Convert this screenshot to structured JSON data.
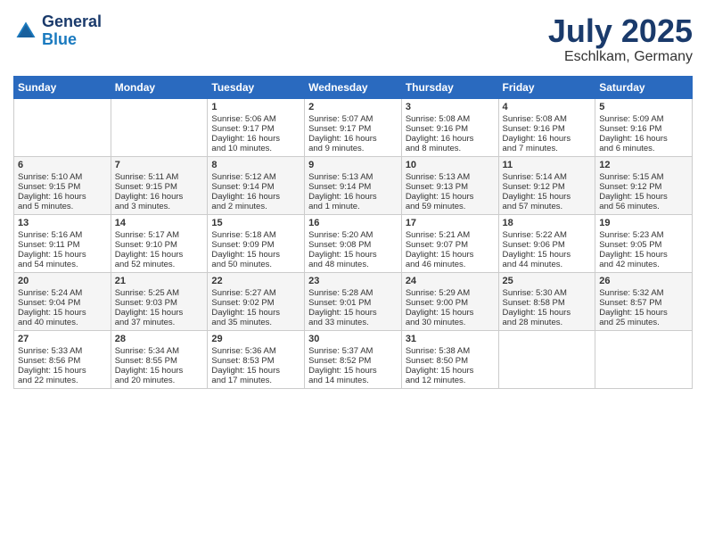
{
  "header": {
    "logo_text_general": "General",
    "logo_text_blue": "Blue",
    "month_year": "July 2025",
    "location": "Eschlkam, Germany"
  },
  "days_of_week": [
    "Sunday",
    "Monday",
    "Tuesday",
    "Wednesday",
    "Thursday",
    "Friday",
    "Saturday"
  ],
  "weeks": [
    [
      {
        "day": "",
        "content": ""
      },
      {
        "day": "",
        "content": ""
      },
      {
        "day": "1",
        "content": "Sunrise: 5:06 AM\nSunset: 9:17 PM\nDaylight: 16 hours\nand 10 minutes."
      },
      {
        "day": "2",
        "content": "Sunrise: 5:07 AM\nSunset: 9:17 PM\nDaylight: 16 hours\nand 9 minutes."
      },
      {
        "day": "3",
        "content": "Sunrise: 5:08 AM\nSunset: 9:16 PM\nDaylight: 16 hours\nand 8 minutes."
      },
      {
        "day": "4",
        "content": "Sunrise: 5:08 AM\nSunset: 9:16 PM\nDaylight: 16 hours\nand 7 minutes."
      },
      {
        "day": "5",
        "content": "Sunrise: 5:09 AM\nSunset: 9:16 PM\nDaylight: 16 hours\nand 6 minutes."
      }
    ],
    [
      {
        "day": "6",
        "content": "Sunrise: 5:10 AM\nSunset: 9:15 PM\nDaylight: 16 hours\nand 5 minutes."
      },
      {
        "day": "7",
        "content": "Sunrise: 5:11 AM\nSunset: 9:15 PM\nDaylight: 16 hours\nand 3 minutes."
      },
      {
        "day": "8",
        "content": "Sunrise: 5:12 AM\nSunset: 9:14 PM\nDaylight: 16 hours\nand 2 minutes."
      },
      {
        "day": "9",
        "content": "Sunrise: 5:13 AM\nSunset: 9:14 PM\nDaylight: 16 hours\nand 1 minute."
      },
      {
        "day": "10",
        "content": "Sunrise: 5:13 AM\nSunset: 9:13 PM\nDaylight: 15 hours\nand 59 minutes."
      },
      {
        "day": "11",
        "content": "Sunrise: 5:14 AM\nSunset: 9:12 PM\nDaylight: 15 hours\nand 57 minutes."
      },
      {
        "day": "12",
        "content": "Sunrise: 5:15 AM\nSunset: 9:12 PM\nDaylight: 15 hours\nand 56 minutes."
      }
    ],
    [
      {
        "day": "13",
        "content": "Sunrise: 5:16 AM\nSunset: 9:11 PM\nDaylight: 15 hours\nand 54 minutes."
      },
      {
        "day": "14",
        "content": "Sunrise: 5:17 AM\nSunset: 9:10 PM\nDaylight: 15 hours\nand 52 minutes."
      },
      {
        "day": "15",
        "content": "Sunrise: 5:18 AM\nSunset: 9:09 PM\nDaylight: 15 hours\nand 50 minutes."
      },
      {
        "day": "16",
        "content": "Sunrise: 5:20 AM\nSunset: 9:08 PM\nDaylight: 15 hours\nand 48 minutes."
      },
      {
        "day": "17",
        "content": "Sunrise: 5:21 AM\nSunset: 9:07 PM\nDaylight: 15 hours\nand 46 minutes."
      },
      {
        "day": "18",
        "content": "Sunrise: 5:22 AM\nSunset: 9:06 PM\nDaylight: 15 hours\nand 44 minutes."
      },
      {
        "day": "19",
        "content": "Sunrise: 5:23 AM\nSunset: 9:05 PM\nDaylight: 15 hours\nand 42 minutes."
      }
    ],
    [
      {
        "day": "20",
        "content": "Sunrise: 5:24 AM\nSunset: 9:04 PM\nDaylight: 15 hours\nand 40 minutes."
      },
      {
        "day": "21",
        "content": "Sunrise: 5:25 AM\nSunset: 9:03 PM\nDaylight: 15 hours\nand 37 minutes."
      },
      {
        "day": "22",
        "content": "Sunrise: 5:27 AM\nSunset: 9:02 PM\nDaylight: 15 hours\nand 35 minutes."
      },
      {
        "day": "23",
        "content": "Sunrise: 5:28 AM\nSunset: 9:01 PM\nDaylight: 15 hours\nand 33 minutes."
      },
      {
        "day": "24",
        "content": "Sunrise: 5:29 AM\nSunset: 9:00 PM\nDaylight: 15 hours\nand 30 minutes."
      },
      {
        "day": "25",
        "content": "Sunrise: 5:30 AM\nSunset: 8:58 PM\nDaylight: 15 hours\nand 28 minutes."
      },
      {
        "day": "26",
        "content": "Sunrise: 5:32 AM\nSunset: 8:57 PM\nDaylight: 15 hours\nand 25 minutes."
      }
    ],
    [
      {
        "day": "27",
        "content": "Sunrise: 5:33 AM\nSunset: 8:56 PM\nDaylight: 15 hours\nand 22 minutes."
      },
      {
        "day": "28",
        "content": "Sunrise: 5:34 AM\nSunset: 8:55 PM\nDaylight: 15 hours\nand 20 minutes."
      },
      {
        "day": "29",
        "content": "Sunrise: 5:36 AM\nSunset: 8:53 PM\nDaylight: 15 hours\nand 17 minutes."
      },
      {
        "day": "30",
        "content": "Sunrise: 5:37 AM\nSunset: 8:52 PM\nDaylight: 15 hours\nand 14 minutes."
      },
      {
        "day": "31",
        "content": "Sunrise: 5:38 AM\nSunset: 8:50 PM\nDaylight: 15 hours\nand 12 minutes."
      },
      {
        "day": "",
        "content": ""
      },
      {
        "day": "",
        "content": ""
      }
    ]
  ]
}
